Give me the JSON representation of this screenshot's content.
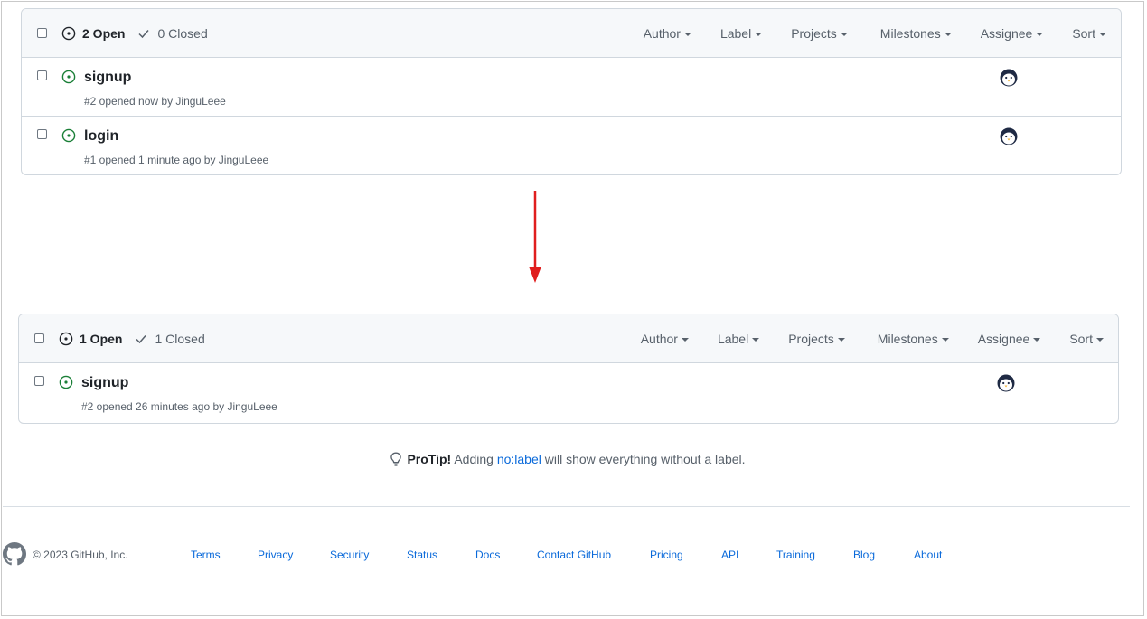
{
  "top_panel": {
    "open_count": "2 Open",
    "closed_count": "0 Closed",
    "filters": [
      "Author",
      "Label",
      "Projects",
      "Milestones",
      "Assignee",
      "Sort"
    ],
    "issues": [
      {
        "title": "signup",
        "meta": "#2 opened now by JinguLeee"
      },
      {
        "title": "login",
        "meta": "#1 opened 1 minute ago by JinguLeee"
      }
    ]
  },
  "bottom_panel": {
    "open_count": "1 Open",
    "closed_count": "1 Closed",
    "filters": [
      "Author",
      "Label",
      "Projects",
      "Milestones",
      "Assignee",
      "Sort"
    ],
    "issues": [
      {
        "title": "signup",
        "meta": "#2 opened 26 minutes ago by JinguLeee"
      }
    ]
  },
  "protip": {
    "bold": "ProTip!",
    "before": " Adding ",
    "link": "no:label",
    "after": " will show everything without a label."
  },
  "footer": {
    "copyright": "© 2023 GitHub, Inc.",
    "links": [
      "Terms",
      "Privacy",
      "Security",
      "Status",
      "Docs",
      "Contact GitHub",
      "Pricing",
      "API",
      "Training",
      "Blog",
      "About"
    ]
  },
  "colors": {
    "open_green": "#1a7f37",
    "link_blue": "#0969da",
    "arrow_red": "#e01e1e"
  }
}
